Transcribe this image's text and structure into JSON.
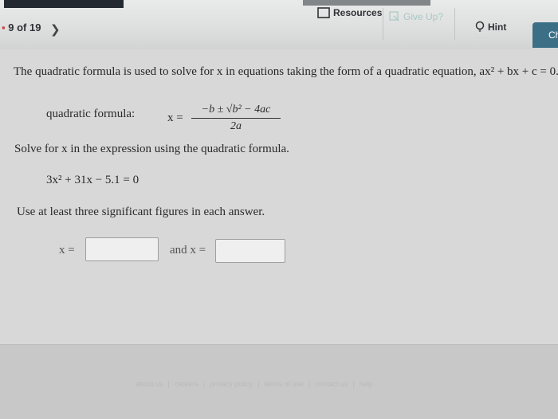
{
  "toolbar": {
    "pager": "9 of 19",
    "resources_label": "Resources",
    "giveup_label": "Give Up?",
    "hint_label": "Hint",
    "ch_label": "Ch"
  },
  "question": {
    "intro": "The quadratic formula is used to solve for x in equations taking the form of a quadratic equation, ax² + bx + c = 0.",
    "qf_label": "quadratic formula:",
    "qf_x": "x =",
    "qf_numerator": "−b ± √b² − 4ac",
    "qf_denominator": "2a",
    "solve_text": "Solve for x in the expression using the quadratic formula.",
    "equation": "3x² + 31x − 5.1 = 0",
    "sigfig_text": "Use at least three significant figures in each answer.",
    "answer1_label": "x =",
    "answer2_label": "and x =",
    "answer1_value": "",
    "answer2_value": ""
  },
  "footer": {
    "links": [
      "about us",
      "careers",
      "privacy policy",
      "terms of use",
      "contact us",
      "help"
    ]
  },
  "colors": {
    "ch_tab": "#3a6f86",
    "giveup_text": "#a9c7c3"
  }
}
